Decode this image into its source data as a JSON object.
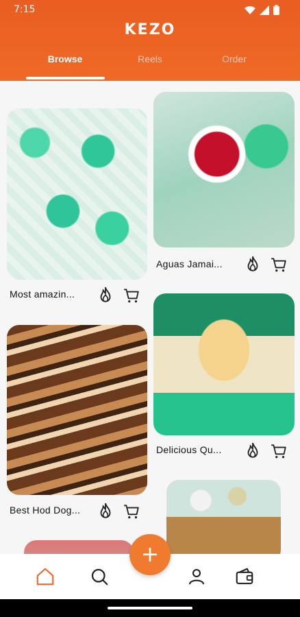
{
  "status_bar": {
    "time": "7:15"
  },
  "app": {
    "logo": "KEZO",
    "accent_color": "#ee6526"
  },
  "tabs": [
    {
      "label": "Browse",
      "active": true
    },
    {
      "label": "Reels",
      "active": false
    },
    {
      "label": "Order",
      "active": false
    }
  ],
  "feed": {
    "cards": [
      {
        "title": "Most amazin...",
        "image": "tacos-on-green-baskets"
      },
      {
        "title": "Aguas Jamai...",
        "image": "red-drink-cup"
      },
      {
        "title": "Best Hod Dog...",
        "image": "hot-dogs"
      },
      {
        "title": "Delicious Qu...",
        "image": "quesadilla"
      },
      {
        "title": "",
        "image": "loaded-fries"
      },
      {
        "title": "",
        "image": "partial-food"
      }
    ],
    "card_icons": [
      "fire-icon",
      "cart-icon"
    ]
  },
  "bottom_nav": {
    "items": [
      "home-icon",
      "search-icon",
      "profile-icon",
      "wallet-icon"
    ],
    "fab": "+"
  }
}
